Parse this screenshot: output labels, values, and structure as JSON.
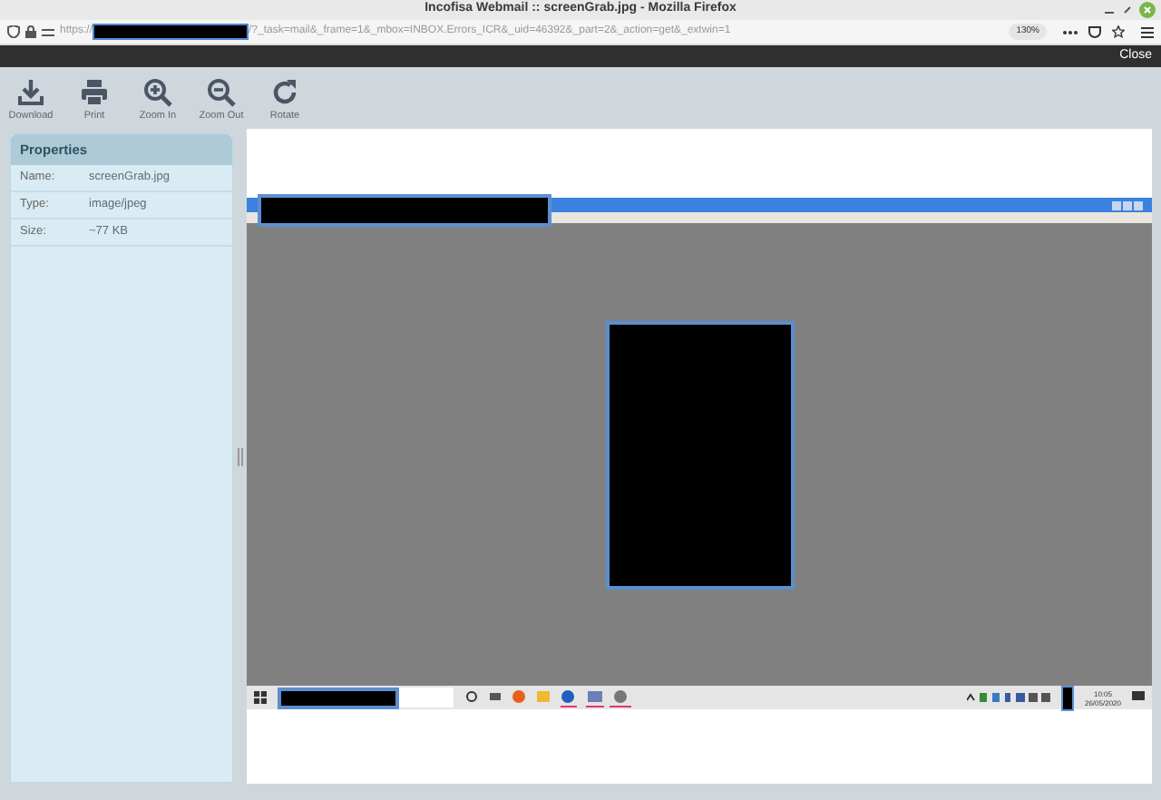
{
  "window": {
    "title": "Incofisa Webmail :: screenGrab.jpg - Mozilla Firefox"
  },
  "address_bar": {
    "prefix": "https://",
    "url": "/?_task=mail&_frame=1&_mbox=INBOX.Errors_ICR&_uid=46392&_part=2&_action=get&_extwin=1",
    "zoom": "130%"
  },
  "header": {
    "close": "Close"
  },
  "toolbar": [
    {
      "kind": "download",
      "label": "Download"
    },
    {
      "kind": "print",
      "label": "Print"
    },
    {
      "kind": "zoomin",
      "label": "Zoom In"
    },
    {
      "kind": "zoomout",
      "label": "Zoom Out"
    },
    {
      "kind": "rotate",
      "label": "Rotate"
    }
  ],
  "properties": {
    "title": "Properties",
    "rows": [
      {
        "label": "Name:",
        "value": "screenGrab.jpg"
      },
      {
        "label": "Type:",
        "value": "image/jpeg"
      },
      {
        "label": "Size:",
        "value": "~77 KB"
      }
    ]
  },
  "preview": {
    "clock_time": "10:05",
    "clock_date": "26/05/2020"
  }
}
